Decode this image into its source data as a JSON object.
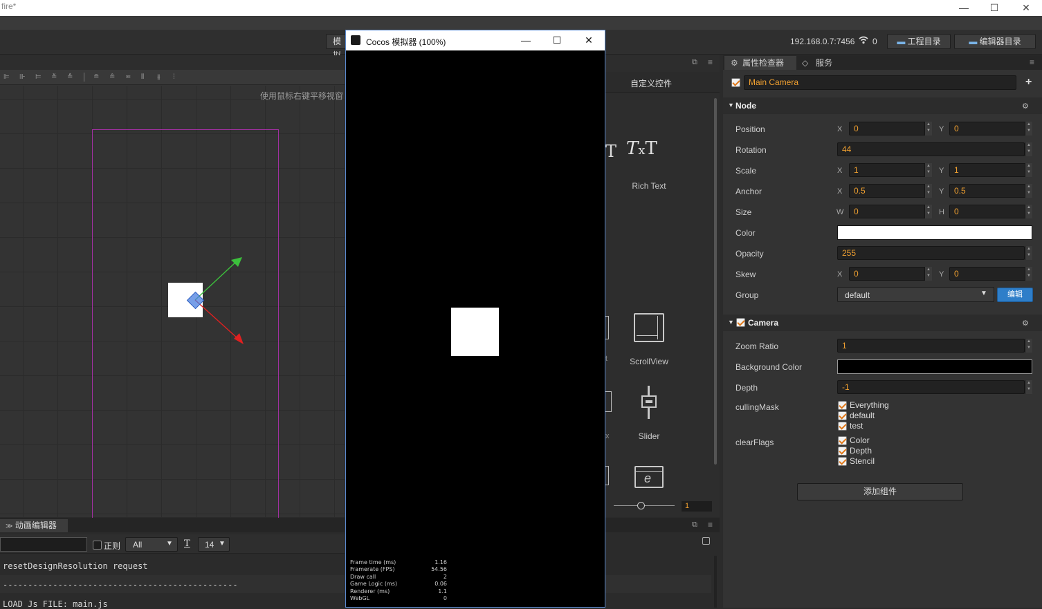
{
  "window": {
    "title": "fire*",
    "minimize": "—",
    "maximize": "☐",
    "close": "✕"
  },
  "topbar": {
    "sim_button_fragment": "模拟",
    "ip": "192.168.0.7:7456",
    "wifi_count": "0",
    "project_dir_btn": "工程目录",
    "editor_dir_btn": "编辑器目录"
  },
  "scene": {
    "hint": "使用鼠标右键平移视窗",
    "axis_start": "0",
    "axis_end": "500"
  },
  "widgets": {
    "title": "自定义控件",
    "items": [
      {
        "label": "Rich Text",
        "icon": "rich-text-icon"
      },
      {
        "label": "ScrollView",
        "icon": "scrollview-icon"
      },
      {
        "label": "Slider",
        "icon": "slider-icon"
      },
      {
        "label": "",
        "icon": "webview-icon"
      }
    ],
    "zoom_value": "1"
  },
  "simulator": {
    "title": "Cocos 模拟器 (100%)",
    "stats": [
      {
        "k": "Frame time (ms)",
        "v": "1.16"
      },
      {
        "k": "Framerate (FPS)",
        "v": "54.56"
      },
      {
        "k": "Draw call",
        "v": "2"
      },
      {
        "k": "Game Logic (ms)",
        "v": "0.06"
      },
      {
        "k": "Renderer (ms)",
        "v": "1.1"
      },
      {
        "k": "WebGL",
        "v": "0"
      }
    ]
  },
  "console": {
    "tab": "动画编辑器",
    "regex_label": "正则",
    "level_select": "All",
    "font_size": "14",
    "lines": [
      "resetDesignResolution request",
      "-----------------------------------------------",
      "LOAD Js FILE: main.js"
    ]
  },
  "inspector": {
    "tabs": [
      "属性检查器",
      "服务"
    ],
    "node_name": "Main Camera",
    "node_section": "Node",
    "props": {
      "position": {
        "label": "Position",
        "x": "0",
        "y": "0"
      },
      "rotation": {
        "label": "Rotation",
        "value": "44"
      },
      "scale": {
        "label": "Scale",
        "x": "1",
        "y": "1"
      },
      "anchor": {
        "label": "Anchor",
        "x": "0.5",
        "y": "0.5"
      },
      "size": {
        "label": "Size",
        "w": "0",
        "h": "0"
      },
      "color": {
        "label": "Color",
        "value": "#ffffff"
      },
      "opacity": {
        "label": "Opacity",
        "value": "255"
      },
      "skew": {
        "label": "Skew",
        "x": "0",
        "y": "0"
      },
      "group": {
        "label": "Group",
        "value": "default",
        "edit_btn": "编辑"
      }
    },
    "axis_labels": {
      "x": "X",
      "y": "Y",
      "w": "W",
      "h": "H"
    },
    "camera_section": "Camera",
    "camera": {
      "zoom_ratio": {
        "label": "Zoom Ratio",
        "value": "1"
      },
      "bg_color": {
        "label": "Background Color",
        "value": "#000000"
      },
      "depth": {
        "label": "Depth",
        "value": "-1"
      },
      "culling_mask": {
        "label": "cullingMask",
        "options": [
          "Everything",
          "default",
          "test"
        ]
      },
      "clear_flags": {
        "label": "clearFlags",
        "options": [
          "Color",
          "Depth",
          "Stencil"
        ]
      }
    },
    "add_component": "添加组件"
  }
}
